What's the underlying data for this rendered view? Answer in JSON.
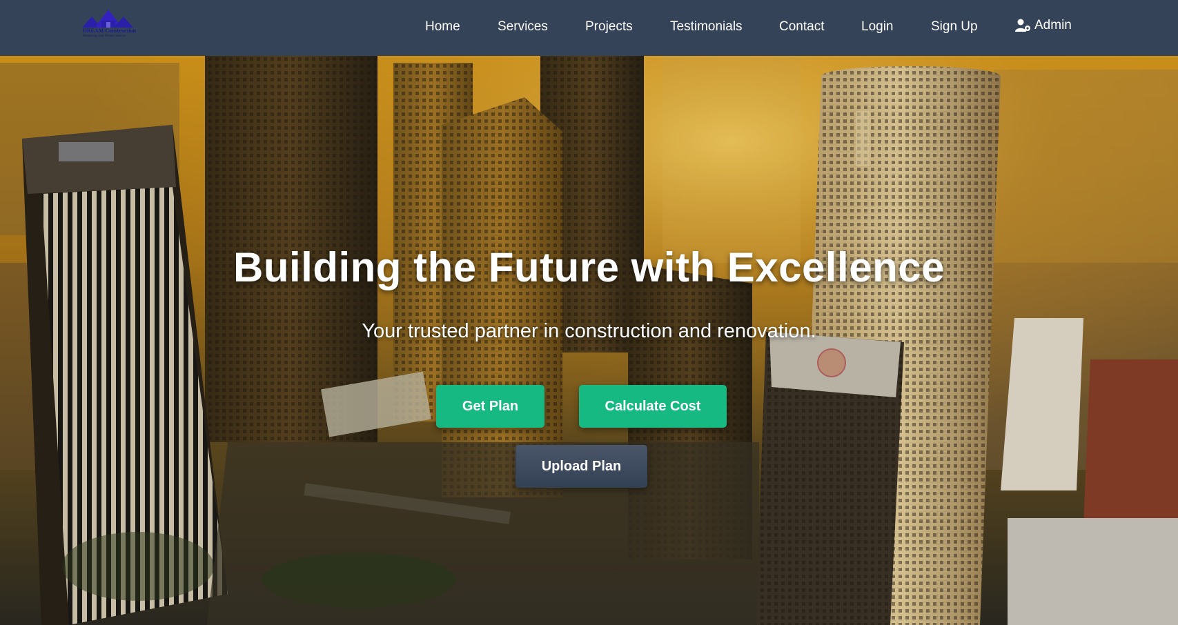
{
  "brand": {
    "name": "DREAM Construction",
    "tagline": "Designing your Dream with us",
    "colors": {
      "navbar": "#344357",
      "accent": "#16b981",
      "dark_button": "#3b4658",
      "logo": "#2a1fa8"
    }
  },
  "nav": {
    "items": [
      {
        "id": "home",
        "label": "Home"
      },
      {
        "id": "services",
        "label": "Services"
      },
      {
        "id": "projects",
        "label": "Projects"
      },
      {
        "id": "testimonials",
        "label": "Testimonials"
      },
      {
        "id": "contact",
        "label": "Contact"
      },
      {
        "id": "login",
        "label": "Login"
      },
      {
        "id": "signup",
        "label": "Sign Up"
      }
    ],
    "admin": {
      "label": "Admin",
      "icon": "user-gear-icon"
    }
  },
  "hero": {
    "title": "Building the Future with Excellence",
    "subtitle": "Your trusted partner in construction and renovation.",
    "buttons": {
      "get_plan": "Get Plan",
      "calculate_cost": "Calculate Cost",
      "upload_plan": "Upload Plan"
    }
  }
}
